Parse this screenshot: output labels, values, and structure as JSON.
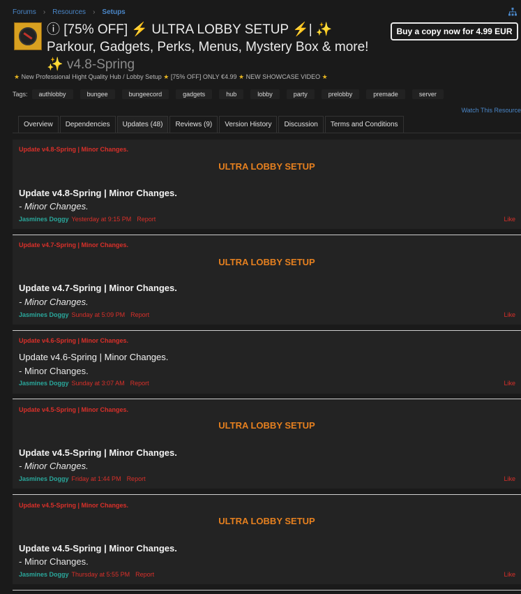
{
  "breadcrumb": {
    "forums": "Forums",
    "resources": "Resources",
    "setups": "Setups"
  },
  "resource": {
    "title": "ⓘ [75% OFF] ⚡ ULTRA LOBBY SETUP ⚡| ✨ Parkour, Gadgets, Perks, Menus, Mystery Box & more! ✨",
    "version": "v4.8-Spring",
    "buy_label": "Buy a copy now for 4.99 EUR",
    "tagline": {
      "part1": "New Professional Hight Quality Hub / Lobby Setup",
      "part2": "[75% OFF] ONLY €4.99",
      "part3": "NEW SHOWCASE VIDEO"
    }
  },
  "tags": {
    "label": "Tags:",
    "items": [
      "authlobby",
      "bungee",
      "bungeecord",
      "gadgets",
      "hub",
      "lobby",
      "party",
      "prelobby",
      "premade",
      "server"
    ]
  },
  "watch_label": "Watch This Resource",
  "tabs": [
    "Overview",
    "Dependencies",
    "Updates (48)",
    "Reviews (9)",
    "Version History",
    "Discussion",
    "Terms and Conditions"
  ],
  "updates": [
    {
      "header": "Update v4.8-Spring | Minor Changes.",
      "banner": "ULTRA LOBBY SETUP",
      "title": "Update v4.8-Spring | Minor Changes.",
      "body": "- Minor Changes.",
      "author": "Jasmines Doggy",
      "time": "Yesterday at 9:15 PM",
      "report": "Report",
      "like": "Like"
    },
    {
      "header": "Update v4.7-Spring | Minor Changes.",
      "banner": "ULTRA LOBBY SETUP",
      "title": "Update v4.7-Spring | Minor Changes.",
      "body": "- Minor Changes.",
      "author": "Jasmines Doggy",
      "time": "Sunday at 5:09 PM",
      "report": "Report",
      "like": "Like"
    },
    {
      "header": "Update v4.6-Spring | Minor Changes.",
      "title": "Update v4.6-Spring | Minor Changes.",
      "body": "- Minor Changes.",
      "author": "Jasmines Doggy",
      "time": "Sunday at 3:07 AM",
      "report": "Report",
      "like": "Like"
    },
    {
      "header": "Update v4.5-Spring | Minor Changes.",
      "banner": "ULTRA LOBBY SETUP",
      "title": "Update v4.5-Spring | Minor Changes.",
      "body": "- Minor Changes.",
      "author": "Jasmines Doggy",
      "time": "Friday at 1:44 PM",
      "report": "Report",
      "like": "Like"
    },
    {
      "header": "Update v4.5-Spring | Minor Changes.",
      "banner": "ULTRA LOBBY SETUP",
      "title": "Update v4.5-Spring | Minor Changes.",
      "body": "- Minor Changes.",
      "author": "Jasmines Doggy",
      "time": "Thursday at 5:55 PM",
      "report": "Report",
      "like": "Like"
    }
  ],
  "colors": {
    "link": "#4a86c7",
    "accent_red": "#d9302a",
    "banner_orange": "#e6801f",
    "author_teal": "#2aa79b",
    "star": "#e4b320"
  }
}
